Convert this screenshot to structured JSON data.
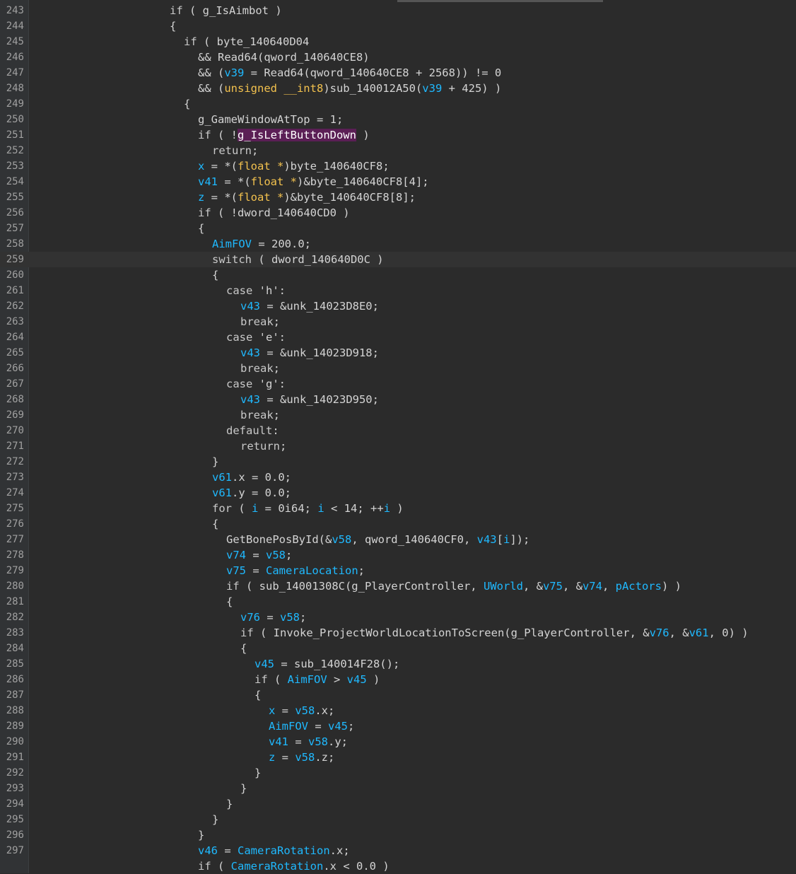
{
  "editor": {
    "current_line": 259
  },
  "lines": [
    {
      "n": "243",
      "indent": 10,
      "tokens": [
        {
          "t": "if",
          "c": "kw"
        },
        {
          "t": " ( g_IsAimbot )",
          "c": ""
        }
      ]
    },
    {
      "n": "244",
      "indent": 10,
      "tokens": [
        {
          "t": "{",
          "c": ""
        }
      ]
    },
    {
      "n": "245",
      "indent": 11,
      "tokens": [
        {
          "t": "if",
          "c": "kw"
        },
        {
          "t": " ( byte_140640D04",
          "c": ""
        }
      ]
    },
    {
      "n": "246",
      "indent": 12,
      "tokens": [
        {
          "t": "&& Read64(qword_140640CE8)",
          "c": ""
        }
      ]
    },
    {
      "n": "247",
      "indent": 12,
      "tokens": [
        {
          "t": "&& (",
          "c": ""
        },
        {
          "t": "v39",
          "c": "var"
        },
        {
          "t": " = Read64(qword_140640CE8 + 2568)) != 0",
          "c": ""
        }
      ]
    },
    {
      "n": "248",
      "indent": 12,
      "tokens": [
        {
          "t": "&& (",
          "c": ""
        },
        {
          "t": "unsigned __int8",
          "c": "type"
        },
        {
          "t": ")sub_140012A50(",
          "c": ""
        },
        {
          "t": "v39",
          "c": "var"
        },
        {
          "t": " + 425) )",
          "c": ""
        }
      ]
    },
    {
      "n": "249",
      "indent": 11,
      "tokens": [
        {
          "t": "{",
          "c": ""
        }
      ]
    },
    {
      "n": "250",
      "indent": 12,
      "tokens": [
        {
          "t": "g_GameWindowAtTop = 1;",
          "c": ""
        }
      ]
    },
    {
      "n": "251",
      "indent": 12,
      "tokens": [
        {
          "t": "if",
          "c": "kw"
        },
        {
          "t": " ( !",
          "c": ""
        },
        {
          "t": "g_IsLeftButtonDown",
          "c": "hl"
        },
        {
          "t": " )",
          "c": ""
        }
      ]
    },
    {
      "n": "252",
      "indent": 13,
      "tokens": [
        {
          "t": "return",
          "c": "kw"
        },
        {
          "t": ";",
          "c": ""
        }
      ]
    },
    {
      "n": "253",
      "indent": 12,
      "tokens": [
        {
          "t": "x",
          "c": "var"
        },
        {
          "t": " = *(",
          "c": ""
        },
        {
          "t": "float *",
          "c": "type"
        },
        {
          "t": ")byte_140640CF8;",
          "c": ""
        }
      ]
    },
    {
      "n": "254",
      "indent": 12,
      "tokens": [
        {
          "t": "v41",
          "c": "var"
        },
        {
          "t": " = *(",
          "c": ""
        },
        {
          "t": "float *",
          "c": "type"
        },
        {
          "t": ")&byte_140640CF8[4];",
          "c": ""
        }
      ]
    },
    {
      "n": "255",
      "indent": 12,
      "tokens": [
        {
          "t": "z",
          "c": "var"
        },
        {
          "t": " = *(",
          "c": ""
        },
        {
          "t": "float *",
          "c": "type"
        },
        {
          "t": ")&byte_140640CF8[8];",
          "c": ""
        }
      ]
    },
    {
      "n": "256",
      "indent": 12,
      "tokens": [
        {
          "t": "if",
          "c": "kw"
        },
        {
          "t": " ( !dword_140640CD0 )",
          "c": ""
        }
      ]
    },
    {
      "n": "257",
      "indent": 12,
      "tokens": [
        {
          "t": "{",
          "c": ""
        }
      ]
    },
    {
      "n": "258",
      "indent": 13,
      "tokens": [
        {
          "t": "AimFOV",
          "c": "var"
        },
        {
          "t": " = 200.0;",
          "c": ""
        }
      ]
    },
    {
      "n": "259",
      "indent": 13,
      "tokens": [
        {
          "t": "switch",
          "c": "kw"
        },
        {
          "t": " ( dword_140640D0C )",
          "c": ""
        }
      ]
    },
    {
      "n": "260",
      "indent": 13,
      "tokens": [
        {
          "t": "{",
          "c": ""
        }
      ]
    },
    {
      "n": "261",
      "indent": 14,
      "tokens": [
        {
          "t": "case",
          "c": "kw"
        },
        {
          "t": " 'h':",
          "c": ""
        }
      ]
    },
    {
      "n": "262",
      "indent": 15,
      "tokens": [
        {
          "t": "v43",
          "c": "var"
        },
        {
          "t": " = &unk_14023D8E0;",
          "c": ""
        }
      ]
    },
    {
      "n": "263",
      "indent": 15,
      "tokens": [
        {
          "t": "break",
          "c": "kw"
        },
        {
          "t": ";",
          "c": ""
        }
      ]
    },
    {
      "n": "264",
      "indent": 14,
      "tokens": [
        {
          "t": "case",
          "c": "kw"
        },
        {
          "t": " 'e':",
          "c": ""
        }
      ]
    },
    {
      "n": "265",
      "indent": 15,
      "tokens": [
        {
          "t": "v43",
          "c": "var"
        },
        {
          "t": " = &unk_14023D918;",
          "c": ""
        }
      ]
    },
    {
      "n": "266",
      "indent": 15,
      "tokens": [
        {
          "t": "break",
          "c": "kw"
        },
        {
          "t": ";",
          "c": ""
        }
      ]
    },
    {
      "n": "267",
      "indent": 14,
      "tokens": [
        {
          "t": "case",
          "c": "kw"
        },
        {
          "t": " 'g':",
          "c": ""
        }
      ]
    },
    {
      "n": "268",
      "indent": 15,
      "tokens": [
        {
          "t": "v43",
          "c": "var"
        },
        {
          "t": " = &unk_14023D950;",
          "c": ""
        }
      ]
    },
    {
      "n": "269",
      "indent": 15,
      "tokens": [
        {
          "t": "break",
          "c": "kw"
        },
        {
          "t": ";",
          "c": ""
        }
      ]
    },
    {
      "n": "270",
      "indent": 14,
      "tokens": [
        {
          "t": "default",
          "c": "kw"
        },
        {
          "t": ":",
          "c": ""
        }
      ]
    },
    {
      "n": "271",
      "indent": 15,
      "tokens": [
        {
          "t": "return",
          "c": "kw"
        },
        {
          "t": ";",
          "c": ""
        }
      ]
    },
    {
      "n": "272",
      "indent": 13,
      "tokens": [
        {
          "t": "}",
          "c": ""
        }
      ]
    },
    {
      "n": "273",
      "indent": 13,
      "tokens": [
        {
          "t": "v61",
          "c": "var"
        },
        {
          "t": ".x = 0.0;",
          "c": ""
        }
      ]
    },
    {
      "n": "274",
      "indent": 13,
      "tokens": [
        {
          "t": "v61",
          "c": "var"
        },
        {
          "t": ".y = 0.0;",
          "c": ""
        }
      ]
    },
    {
      "n": "275",
      "indent": 13,
      "tokens": [
        {
          "t": "for",
          "c": "kw"
        },
        {
          "t": " ( ",
          "c": ""
        },
        {
          "t": "i",
          "c": "var"
        },
        {
          "t": " = 0i64; ",
          "c": ""
        },
        {
          "t": "i",
          "c": "var"
        },
        {
          "t": " < 14; ++",
          "c": ""
        },
        {
          "t": "i",
          "c": "var"
        },
        {
          "t": " )",
          "c": ""
        }
      ]
    },
    {
      "n": "276",
      "indent": 13,
      "tokens": [
        {
          "t": "{",
          "c": ""
        }
      ]
    },
    {
      "n": "277",
      "indent": 14,
      "tokens": [
        {
          "t": "GetBonePosById(&",
          "c": ""
        },
        {
          "t": "v58",
          "c": "var"
        },
        {
          "t": ", qword_140640CF0, ",
          "c": ""
        },
        {
          "t": "v43",
          "c": "var"
        },
        {
          "t": "[",
          "c": ""
        },
        {
          "t": "i",
          "c": "var"
        },
        {
          "t": "]);",
          "c": ""
        }
      ]
    },
    {
      "n": "278",
      "indent": 14,
      "tokens": [
        {
          "t": "v74",
          "c": "var"
        },
        {
          "t": " = ",
          "c": ""
        },
        {
          "t": "v58",
          "c": "var"
        },
        {
          "t": ";",
          "c": ""
        }
      ]
    },
    {
      "n": "279",
      "indent": 14,
      "tokens": [
        {
          "t": "v75",
          "c": "var"
        },
        {
          "t": " = ",
          "c": ""
        },
        {
          "t": "CameraLocation",
          "c": "var"
        },
        {
          "t": ";",
          "c": ""
        }
      ]
    },
    {
      "n": "280",
      "indent": 14,
      "tokens": [
        {
          "t": "if",
          "c": "kw"
        },
        {
          "t": " ( sub_14001308C(g_PlayerController, ",
          "c": ""
        },
        {
          "t": "UWorld",
          "c": "var"
        },
        {
          "t": ", &",
          "c": ""
        },
        {
          "t": "v75",
          "c": "var"
        },
        {
          "t": ", &",
          "c": ""
        },
        {
          "t": "v74",
          "c": "var"
        },
        {
          "t": ", ",
          "c": ""
        },
        {
          "t": "pActors",
          "c": "var"
        },
        {
          "t": ") )",
          "c": ""
        }
      ]
    },
    {
      "n": "281",
      "indent": 14,
      "tokens": [
        {
          "t": "{",
          "c": ""
        }
      ]
    },
    {
      "n": "282",
      "indent": 15,
      "tokens": [
        {
          "t": "v76",
          "c": "var"
        },
        {
          "t": " = ",
          "c": ""
        },
        {
          "t": "v58",
          "c": "var"
        },
        {
          "t": ";",
          "c": ""
        }
      ]
    },
    {
      "n": "283",
      "indent": 15,
      "tokens": [
        {
          "t": "if",
          "c": "kw"
        },
        {
          "t": " ( Invoke_ProjectWorldLocationToScreen(g_PlayerController, &",
          "c": ""
        },
        {
          "t": "v76",
          "c": "var"
        },
        {
          "t": ", &",
          "c": ""
        },
        {
          "t": "v61",
          "c": "var"
        },
        {
          "t": ", 0) )",
          "c": ""
        }
      ]
    },
    {
      "n": "284",
      "indent": 15,
      "tokens": [
        {
          "t": "{",
          "c": ""
        }
      ]
    },
    {
      "n": "285",
      "indent": 16,
      "tokens": [
        {
          "t": "v45",
          "c": "var"
        },
        {
          "t": " = sub_140014F28();",
          "c": ""
        }
      ]
    },
    {
      "n": "286",
      "indent": 16,
      "tokens": [
        {
          "t": "if",
          "c": "kw"
        },
        {
          "t": " ( ",
          "c": ""
        },
        {
          "t": "AimFOV",
          "c": "var"
        },
        {
          "t": " > ",
          "c": ""
        },
        {
          "t": "v45",
          "c": "var"
        },
        {
          "t": " )",
          "c": ""
        }
      ]
    },
    {
      "n": "287",
      "indent": 16,
      "tokens": [
        {
          "t": "{",
          "c": ""
        }
      ]
    },
    {
      "n": "288",
      "indent": 17,
      "tokens": [
        {
          "t": "x",
          "c": "var"
        },
        {
          "t": " = ",
          "c": ""
        },
        {
          "t": "v58",
          "c": "var"
        },
        {
          "t": ".x;",
          "c": ""
        }
      ]
    },
    {
      "n": "289",
      "indent": 17,
      "tokens": [
        {
          "t": "AimFOV",
          "c": "var"
        },
        {
          "t": " = ",
          "c": ""
        },
        {
          "t": "v45",
          "c": "var"
        },
        {
          "t": ";",
          "c": ""
        }
      ]
    },
    {
      "n": "290",
      "indent": 17,
      "tokens": [
        {
          "t": "v41",
          "c": "var"
        },
        {
          "t": " = ",
          "c": ""
        },
        {
          "t": "v58",
          "c": "var"
        },
        {
          "t": ".y;",
          "c": ""
        }
      ]
    },
    {
      "n": "291",
      "indent": 17,
      "tokens": [
        {
          "t": "z",
          "c": "var"
        },
        {
          "t": " = ",
          "c": ""
        },
        {
          "t": "v58",
          "c": "var"
        },
        {
          "t": ".z;",
          "c": ""
        }
      ]
    },
    {
      "n": "292",
      "indent": 16,
      "tokens": [
        {
          "t": "}",
          "c": ""
        }
      ]
    },
    {
      "n": "293",
      "indent": 15,
      "tokens": [
        {
          "t": "}",
          "c": ""
        }
      ]
    },
    {
      "n": "294",
      "indent": 14,
      "tokens": [
        {
          "t": "}",
          "c": ""
        }
      ]
    },
    {
      "n": "295",
      "indent": 13,
      "tokens": [
        {
          "t": "}",
          "c": ""
        }
      ]
    },
    {
      "n": "296",
      "indent": 12,
      "tokens": [
        {
          "t": "}",
          "c": ""
        }
      ]
    },
    {
      "n": "297",
      "indent": 12,
      "tokens": [
        {
          "t": "v46",
          "c": "var"
        },
        {
          "t": " = ",
          "c": ""
        },
        {
          "t": "CameraRotation",
          "c": "var"
        },
        {
          "t": ".x;",
          "c": ""
        }
      ]
    },
    {
      "n": "",
      "indent": 12,
      "tokens": [
        {
          "t": "if",
          "c": "kw"
        },
        {
          "t": " ( ",
          "c": ""
        },
        {
          "t": "CameraRotation",
          "c": "var"
        },
        {
          "t": ".x < 0.0 )",
          "c": ""
        }
      ]
    }
  ]
}
